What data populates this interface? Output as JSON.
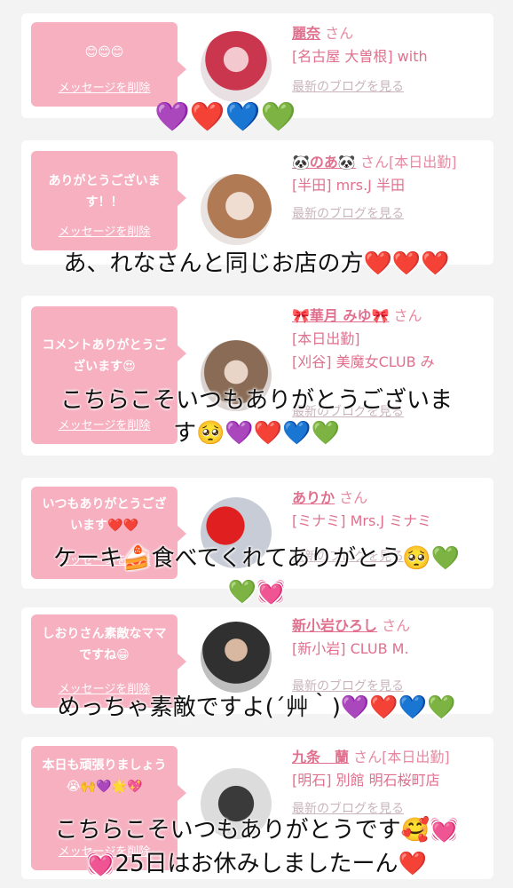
{
  "cards": [
    {
      "bubble": "😊😊😊",
      "delete_label": "メッセージを削除",
      "name": "麗奈",
      "honorific": "さん",
      "shop": "[名古屋 大曽根] with",
      "blog": "最新のブログを見る"
    },
    {
      "bubble": "ありがとうございます！！",
      "delete_label": "メッセージを削除",
      "name": "🐼のあ🐼",
      "honorific": "さん[本日出勤]",
      "shop": "[半田] mrs.J 半田",
      "blog": "最新のブログを見る"
    },
    {
      "bubble": "コメントありがとうございます😍",
      "delete_label": "メッセージを削除",
      "name": "🎀華月 みゆ🎀",
      "honorific": "さん",
      "status": "[本日出勤]",
      "shop": "[刈谷] 美魔女CLUB み",
      "blog": "最新のブログを見る"
    },
    {
      "bubble": "いつもありがとうございます❤️❤️",
      "delete_label": "メッセージを削除",
      "name": "ありか",
      "honorific": "さん",
      "shop": "[ミナミ] Mrs.J ミナミ",
      "blog": "最新のブログを見る"
    },
    {
      "bubble": "しおりさん素敵なママですね😁",
      "delete_label": "メッセージを削除",
      "name": "新小岩ひろし",
      "honorific": "さん",
      "shop": "[新小岩] CLUB M.",
      "blog": "最新のブログを見る"
    },
    {
      "bubble": "本日も頑張りましょう😭🙌💜🌟💖",
      "delete_label": "メッセージを削除",
      "name": "九条　蘭",
      "honorific": "さん[本日出勤]",
      "shop": "[明石] 別館 明石桜町店",
      "blog": "最新のブログを見る"
    }
  ],
  "overlays": {
    "hearts1": "💜❤️💙💚",
    "line1": "あ、れなさんと同じお店の方❤️❤️❤️",
    "line2a": "こちらこそいつもありがとうございま",
    "line2b": "す🥺💜❤️💙💚",
    "line3a": "ケーキ🍰食べてくれてありがとう🥺💚",
    "line3b": "💚💓",
    "line4": "めっちゃ素敵ですよ(´艸｀)💜❤️💙💚",
    "line5a": "こちらこそいつもありがとうです🥰💓",
    "line5b": "💓25日はお休みしましたーん❤️"
  },
  "colors": {
    "bubble": "#f6b0c0",
    "accent": "#e0708e",
    "background": "#f3f3f3"
  }
}
